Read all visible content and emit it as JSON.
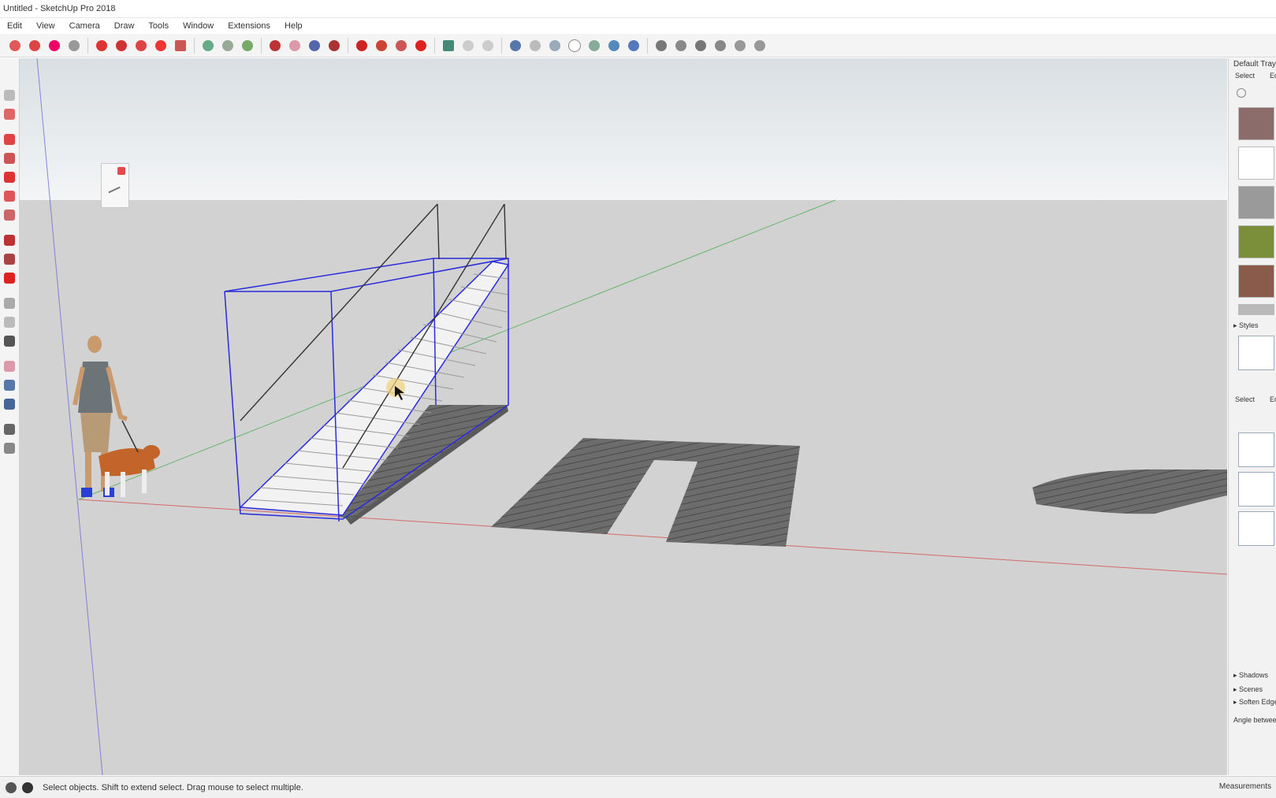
{
  "window": {
    "title": "Untitled - SketchUp Pro 2018"
  },
  "menu": [
    "Edit",
    "View",
    "Camera",
    "Draw",
    "Tools",
    "Window",
    "Extensions",
    "Help"
  ],
  "status": {
    "text": "Select objects. Shift to extend select. Drag mouse to select multiple.",
    "measurements_label": "Measurements"
  },
  "right_panel": {
    "title": "Default Tray",
    "materials_tabs": [
      "Select",
      "Edit"
    ],
    "material_swatches": [
      "#8c6b6b",
      "#ffffff",
      "#9a9a9a",
      "#7b8f3a",
      "#8a5a4a",
      "#b9b9b9"
    ],
    "styles_section": "Styles",
    "styles_tabs": [
      "Select",
      "Edit"
    ],
    "collapsed_sections": [
      "Shadows",
      "Scenes",
      "Soften Edges"
    ],
    "bottom_label": "Angle between"
  },
  "colors": {
    "sky_top": "#d9dfe3",
    "sky_bottom": "#f3f5f6",
    "ground": "#d2d2d2",
    "selection": "#2b2bdc",
    "red_axis": "#d46a6a",
    "green_axis": "#4caf50",
    "blue_axis": "#6c6cd6"
  }
}
